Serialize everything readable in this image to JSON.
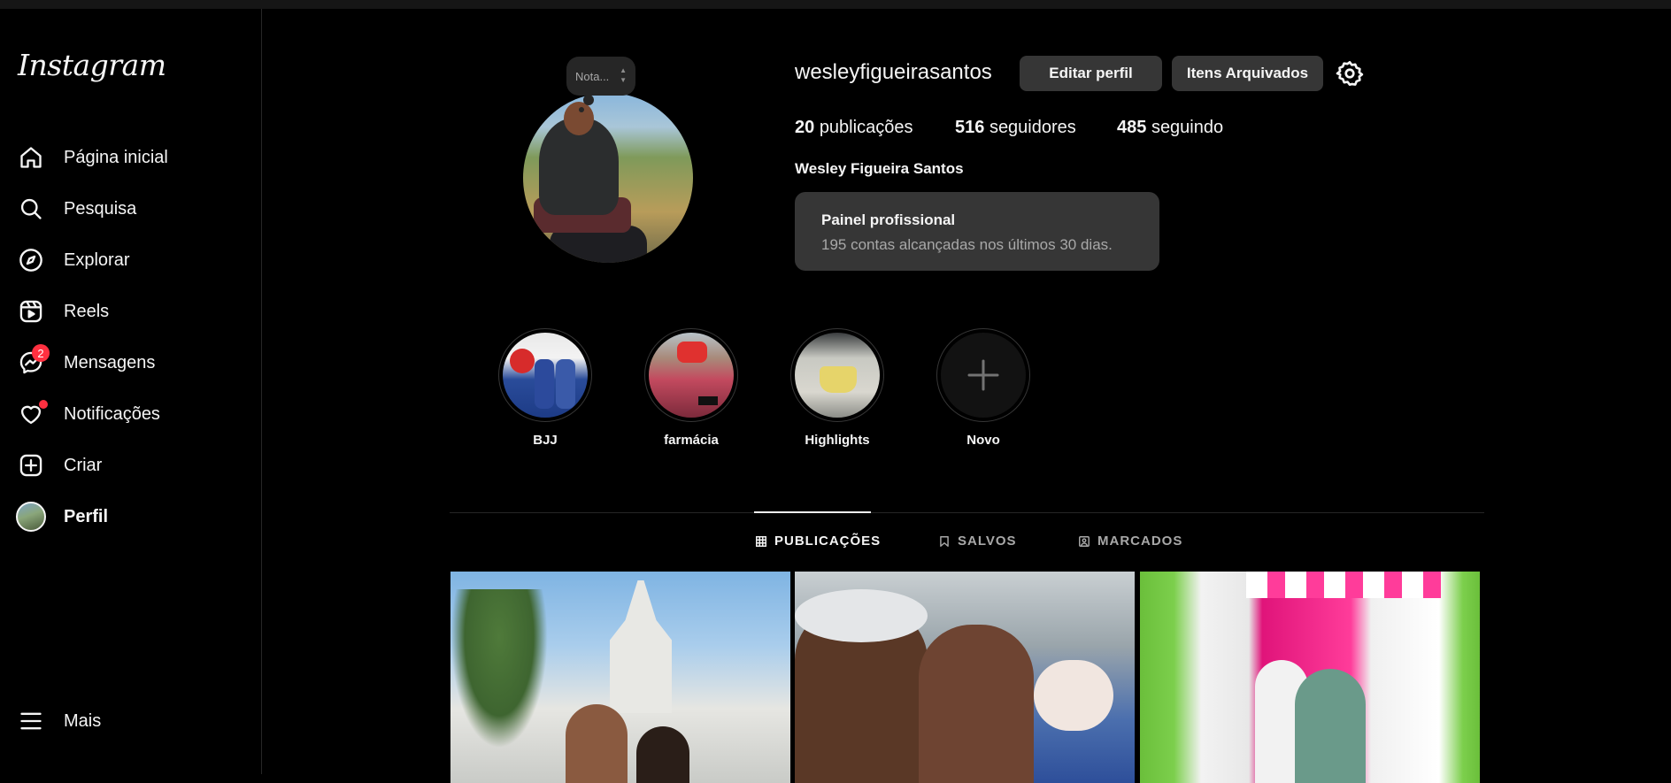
{
  "app": {
    "logo_text": "Instagram"
  },
  "sidebar": {
    "items": [
      {
        "label": "Página inicial",
        "icon": "home-icon"
      },
      {
        "label": "Pesquisa",
        "icon": "search-icon"
      },
      {
        "label": "Explorar",
        "icon": "compass-icon"
      },
      {
        "label": "Reels",
        "icon": "reels-icon"
      },
      {
        "label": "Mensagens",
        "icon": "messenger-icon",
        "badge": "2"
      },
      {
        "label": "Notificações",
        "icon": "heart-icon",
        "has_dot": true
      },
      {
        "label": "Criar",
        "icon": "plus-square-icon"
      },
      {
        "label": "Perfil",
        "icon": "avatar"
      }
    ],
    "more": {
      "label": "Mais",
      "icon": "menu-icon"
    }
  },
  "profile": {
    "note_placeholder": "Nota...",
    "username": "wesleyfigueirasantos",
    "edit_button": "Editar perfil",
    "archive_button": "Itens Arquivados",
    "stats": {
      "posts_count": "20",
      "posts_label": "publicações",
      "followers_count": "516",
      "followers_label": "seguidores",
      "following_count": "485",
      "following_label": "seguindo"
    },
    "full_name": "Wesley Figueira Santos",
    "dashboard": {
      "title": "Painel profissional",
      "subtitle": "195 contas alcançadas nos últimos 30 dias."
    }
  },
  "highlights": [
    {
      "label": "BJJ"
    },
    {
      "label": "farmácia"
    },
    {
      "label": "Highlights"
    },
    {
      "label": "Novo"
    }
  ],
  "tabs": [
    {
      "label": "PUBLICAÇÕES",
      "icon": "grid-icon",
      "active": true
    },
    {
      "label": "SALVOS",
      "icon": "bookmark-icon",
      "active": false
    },
    {
      "label": "MARCADOS",
      "icon": "tagged-icon",
      "active": false
    }
  ],
  "colors": {
    "background": "#000000",
    "button": "#363636",
    "badge": "#ff3040",
    "muted_text": "#a8a8a8"
  }
}
